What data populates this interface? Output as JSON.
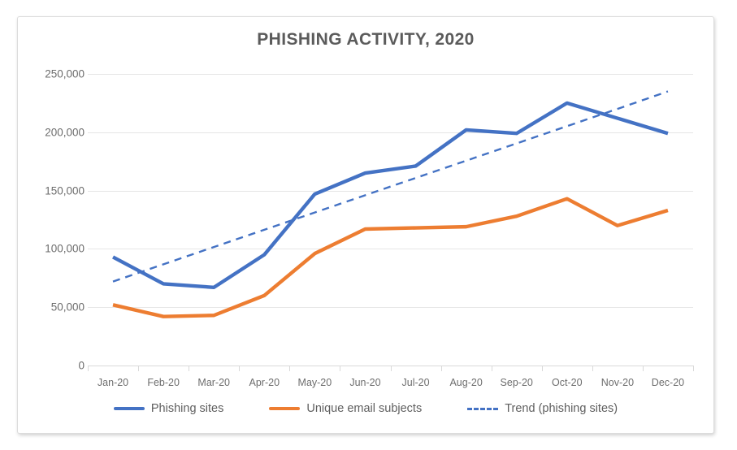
{
  "chart_data": {
    "type": "line",
    "title": "PHISHING ACTIVITY, 2020",
    "xlabel": "",
    "ylabel": "",
    "ylim": [
      0,
      250000
    ],
    "y_ticks": [
      0,
      50000,
      100000,
      150000,
      200000,
      250000
    ],
    "y_tick_labels": [
      "0",
      "50,000",
      "100,000",
      "150,000",
      "200,000",
      "250,000"
    ],
    "grid": true,
    "legend_position": "bottom",
    "categories": [
      "Jan-20",
      "Feb-20",
      "Mar-20",
      "Apr-20",
      "May-20",
      "Jun-20",
      "Jul-20",
      "Aug-20",
      "Sep-20",
      "Oct-20",
      "Nov-20",
      "Dec-20"
    ],
    "series": [
      {
        "name": "Phishing sites",
        "color": "#4472C4",
        "style": "solid",
        "values": [
          93000,
          70000,
          67000,
          95000,
          147000,
          165000,
          171000,
          202000,
          199000,
          225000,
          212000,
          199000
        ]
      },
      {
        "name": "Unique email subjects",
        "color": "#ED7D31",
        "style": "solid",
        "values": [
          52000,
          42000,
          43000,
          60000,
          96000,
          117000,
          118000,
          119000,
          128000,
          143000,
          120000,
          133000
        ]
      },
      {
        "name": "Trend (phishing sites)",
        "color": "#4472C4",
        "style": "dashed",
        "values": [
          72000,
          86800,
          101600,
          116400,
          131200,
          146000,
          160800,
          175600,
          190400,
          205200,
          220000,
          235000
        ]
      }
    ]
  },
  "legend": {
    "items": [
      {
        "label": "Phishing sites",
        "color": "#4472C4",
        "style": "solid"
      },
      {
        "label": "Unique email subjects",
        "color": "#ED7D31",
        "style": "solid"
      },
      {
        "label": "Trend (phishing sites)",
        "color": "#4472C4",
        "style": "dashed"
      }
    ]
  },
  "colors": {
    "title": "#5b5b5b",
    "axis_text": "#6d6d6d",
    "gridline": "#e6e6e6",
    "series_blue": "#4472C4",
    "series_orange": "#ED7D31",
    "frame_border": "#dcdcdc"
  }
}
